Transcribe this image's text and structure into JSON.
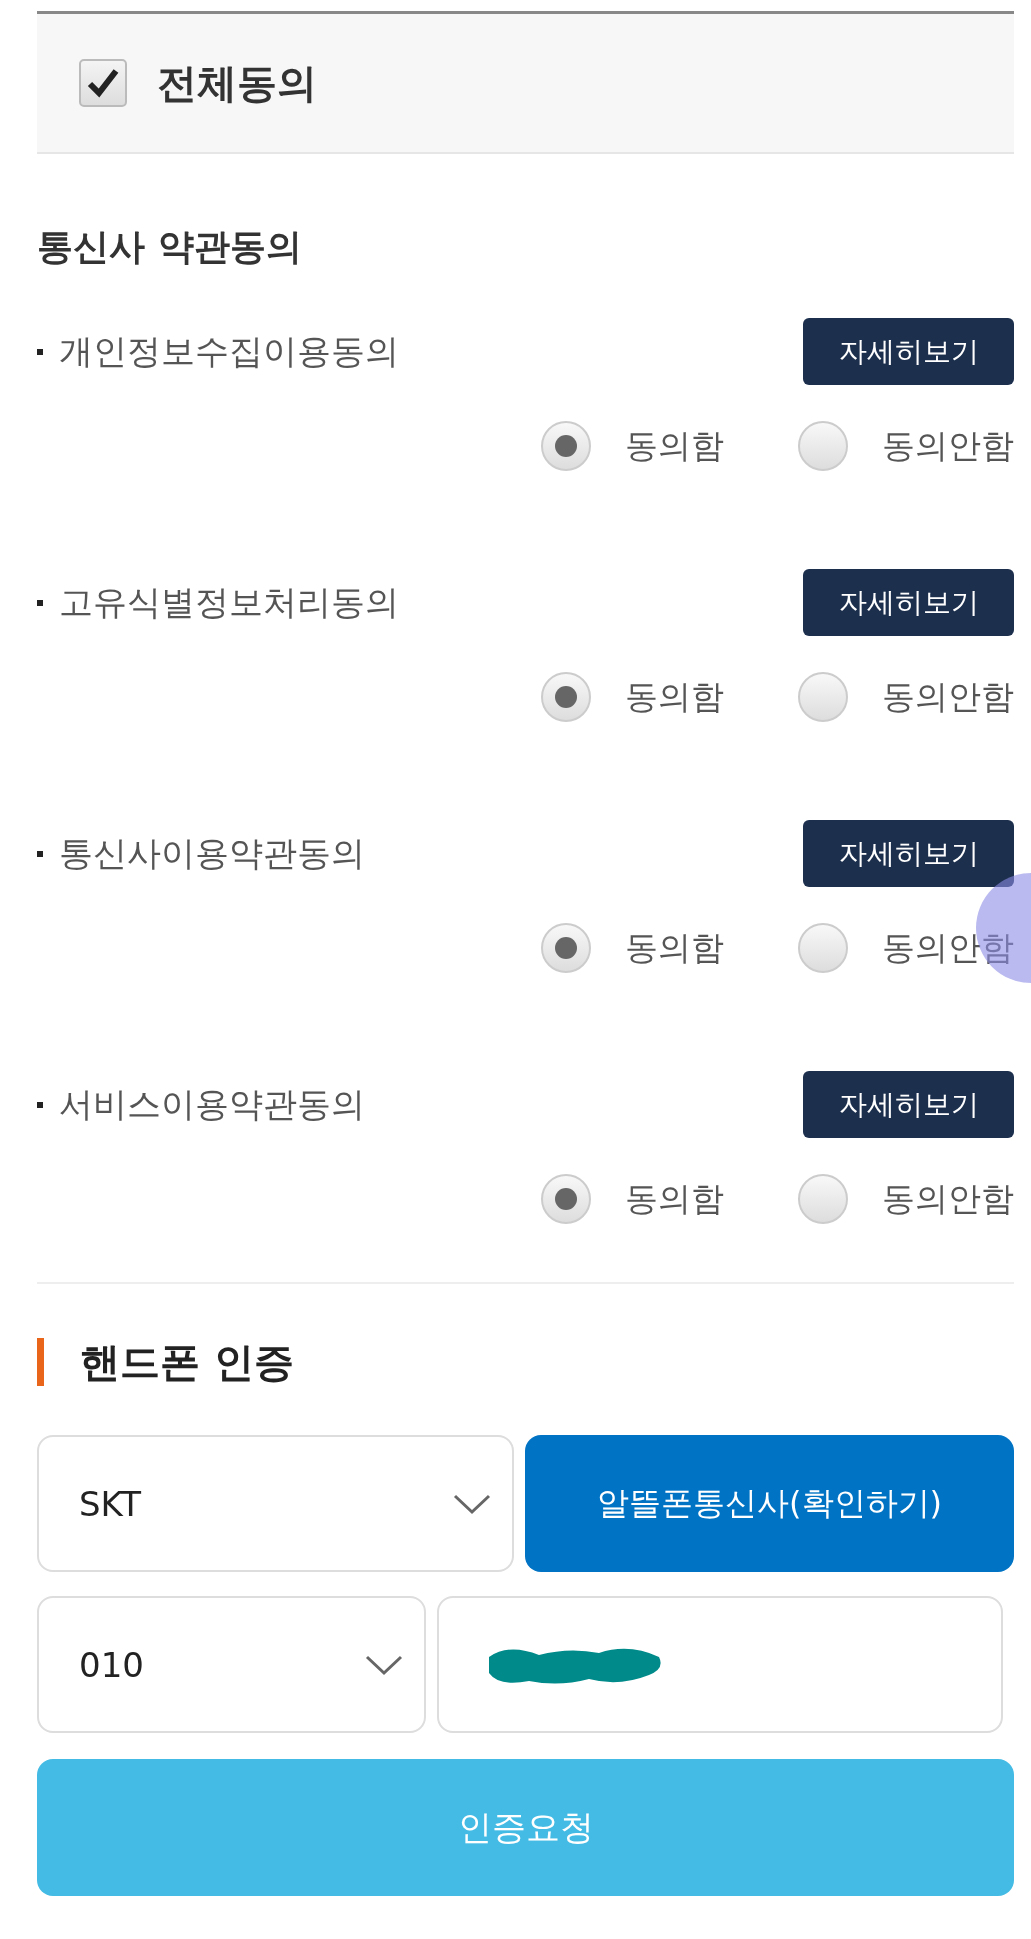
{
  "agree_all": {
    "label": "전체동의",
    "checked": true
  },
  "section_title": "통신사 약관동의",
  "consents": [
    {
      "title": "개인정보수집이용동의",
      "detail_button": "자세히보기",
      "options": [
        {
          "label": "동의함",
          "selected": true
        },
        {
          "label": "동의안함",
          "selected": false
        }
      ]
    },
    {
      "title": "고유식별정보처리동의",
      "detail_button": "자세히보기",
      "options": [
        {
          "label": "동의함",
          "selected": true
        },
        {
          "label": "동의안함",
          "selected": false
        }
      ]
    },
    {
      "title": "통신사이용약관동의",
      "detail_button": "자세히보기",
      "options": [
        {
          "label": "동의함",
          "selected": true
        },
        {
          "label": "동의안함",
          "selected": false
        }
      ]
    },
    {
      "title": "서비스이용약관동의",
      "detail_button": "자세히보기",
      "options": [
        {
          "label": "동의함",
          "selected": true
        },
        {
          "label": "동의안함",
          "selected": false
        }
      ]
    }
  ],
  "phone_auth": {
    "title": "핸드폰 인증",
    "carrier": {
      "value": "SKT"
    },
    "mvno_button": "알뜰폰통신사(확인하기)",
    "prefix": {
      "value": "010"
    },
    "number": {
      "redacted": true
    },
    "submit_button": "인증요청"
  }
}
